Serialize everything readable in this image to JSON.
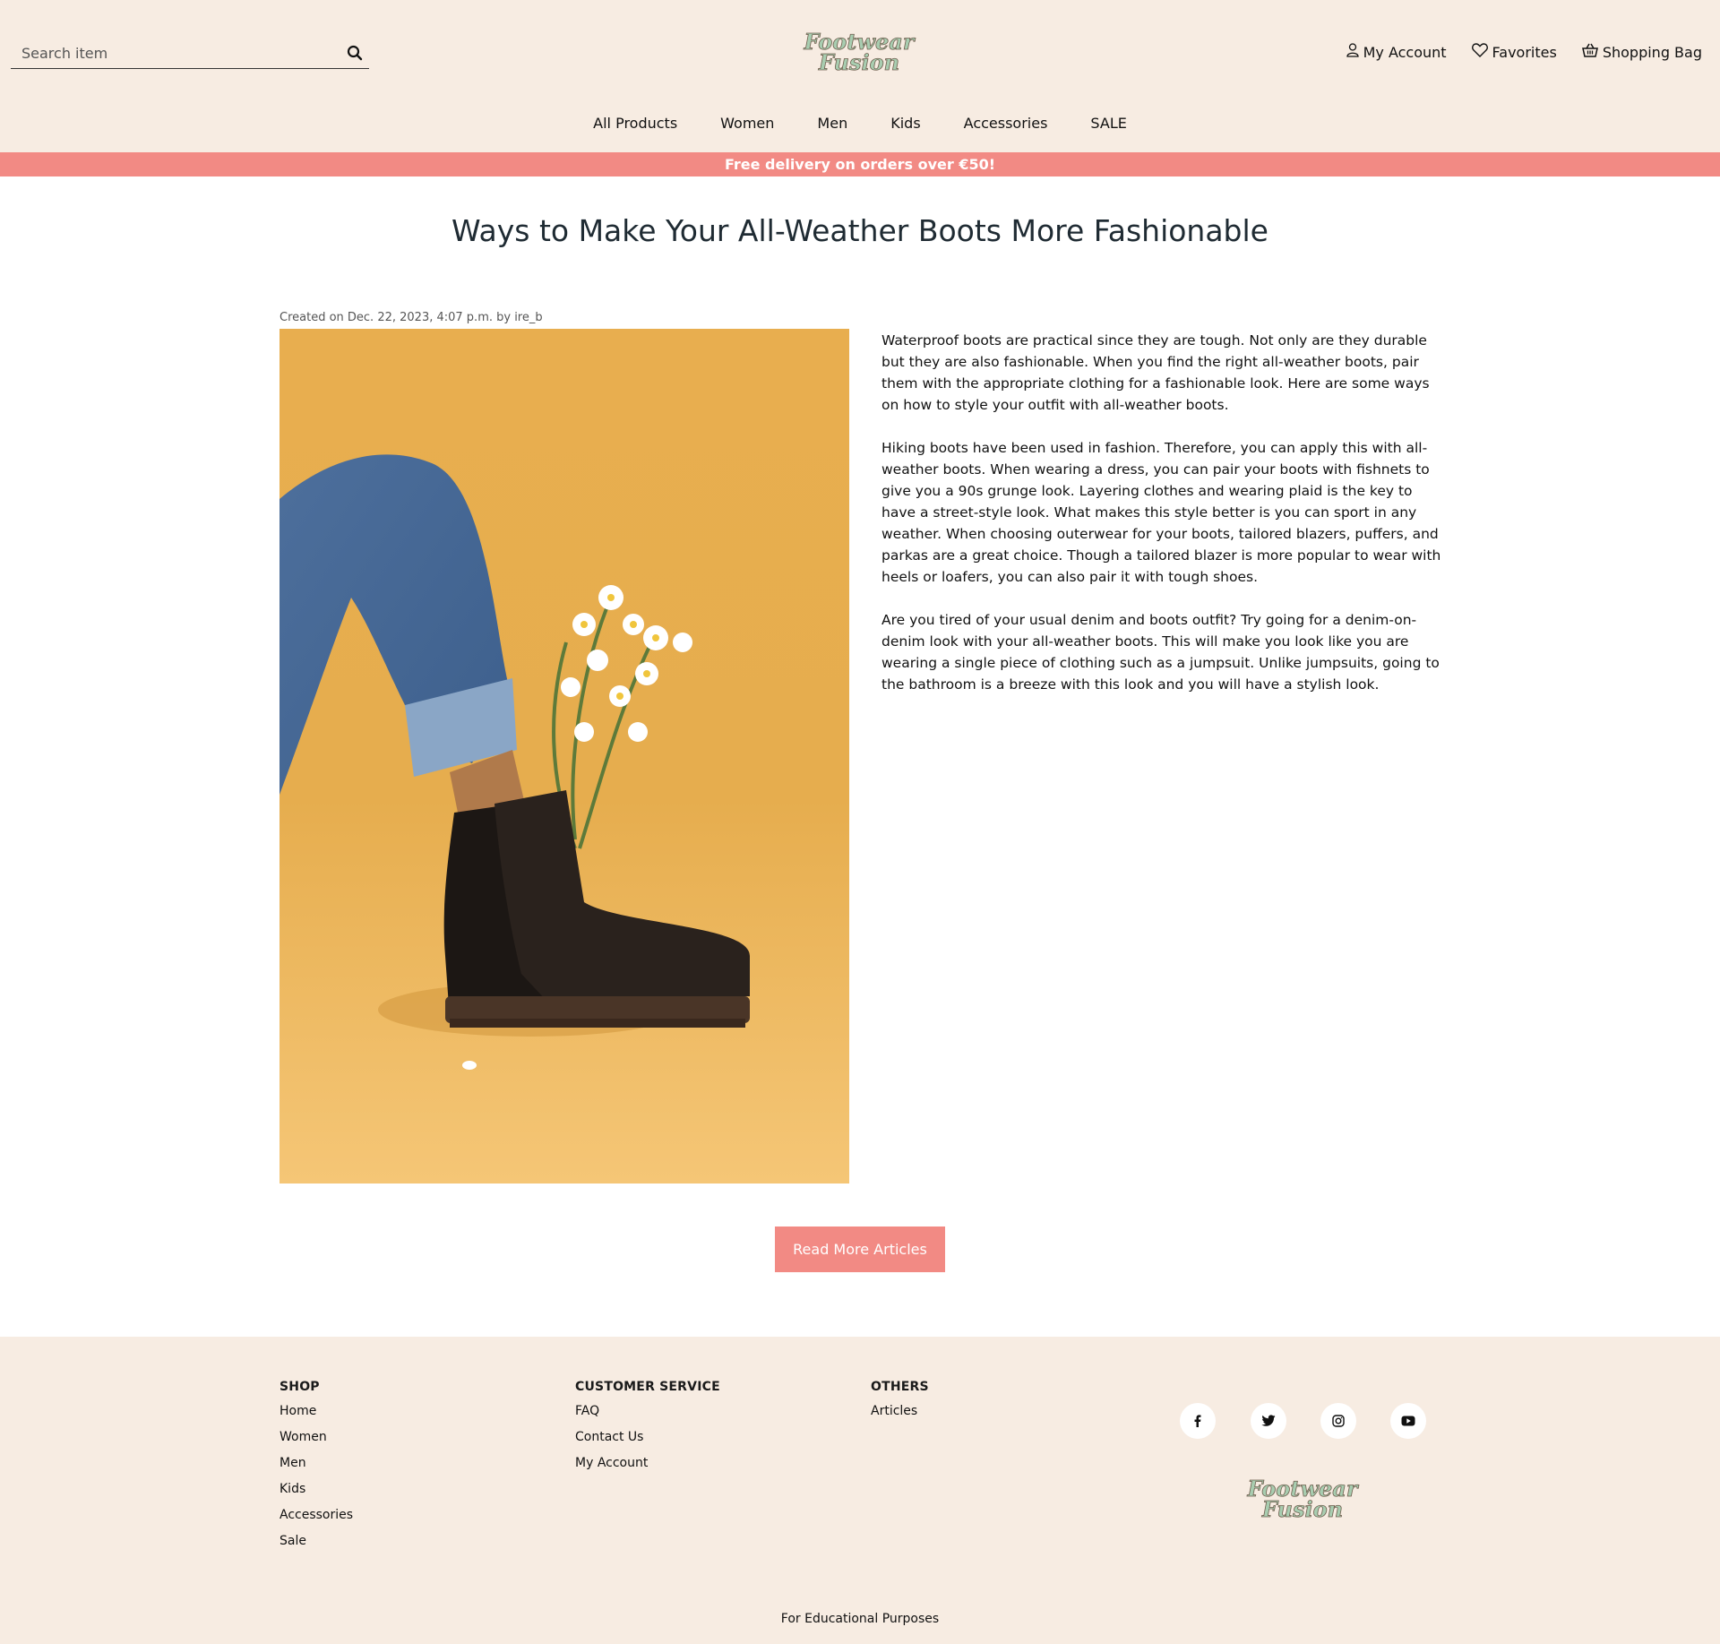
{
  "header": {
    "search_placeholder": "Search item",
    "brand_logo_text": "Footwear Fusion",
    "account_links": [
      {
        "label": "My Account",
        "icon": "user-icon"
      },
      {
        "label": "Favorites",
        "icon": "heart-icon"
      },
      {
        "label": "Shopping Bag",
        "icon": "basket-icon"
      }
    ],
    "nav": [
      "All Products",
      "Women",
      "Men",
      "Kids",
      "Accessories",
      "SALE"
    ]
  },
  "promo": {
    "text": "Free delivery on orders over €50!"
  },
  "article": {
    "title": "Ways to Make Your All-Weather Boots More Fashionable",
    "meta": "Created on Dec. 22, 2023, 4:07 p.m. by ire_b",
    "paragraphs": [
      "Waterproof boots are practical since they are tough. Not only are they durable but they are also fashionable. When you find the right all-weather boots, pair them with the appropriate clothing for a fashionable look. Here are some ways on how to style your outfit with all-weather boots.",
      "Hiking boots have been used in fashion. Therefore, you can apply this with all-weather boots. When wearing a dress, you can pair your boots with fishnets to give you a 90s grunge look. Layering clothes and wearing plaid is the key to have a street-style look. What makes this style better is you can sport in any weather. When choosing outerwear for your boots, tailored blazers, puffers, and parkas are a great choice. Though a tailored blazer is more popular to wear with heels or loafers, you can also pair it with tough shoes.",
      "Are you tired of your usual denim and boots outfit? Try going for a denim-on-denim look with your all-weather boots. This will make you look like you are wearing a single piece of clothing such as a jumpsuit. Unlike jumpsuits, going to the bathroom is a breeze with this look and you will have a stylish look."
    ],
    "read_more_label": "Read More Articles"
  },
  "footer": {
    "shop": {
      "heading": "SHOP",
      "links": [
        "Home",
        "Women",
        "Men",
        "Kids",
        "Accessories",
        "Sale"
      ]
    },
    "customer_service": {
      "heading": "CUSTOMER SERVICE",
      "links": [
        "FAQ",
        "Contact Us",
        "My Account"
      ]
    },
    "others": {
      "heading": "OTHERS",
      "links": [
        "Articles"
      ]
    },
    "social": [
      "facebook-icon",
      "twitter-icon",
      "instagram-icon",
      "youtube-icon"
    ],
    "note": "For Educational Purposes"
  },
  "colors": {
    "header_bg": "#f7ece2",
    "accent": "#f28a84",
    "hero_bg": "#e8ae4f",
    "logo_green": "#7fa98a"
  }
}
